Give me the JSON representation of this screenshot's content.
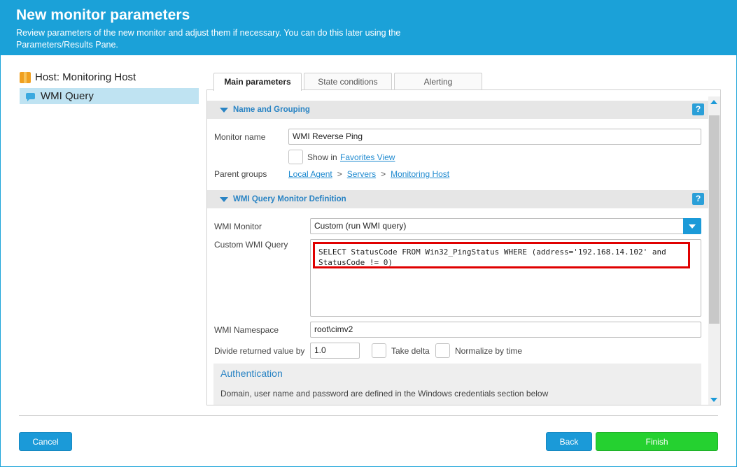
{
  "header": {
    "title": "New monitor parameters",
    "subtitle": "Review parameters of the new monitor and adjust them if necessary. You can do this later using the Parameters/Results Pane."
  },
  "tree": {
    "host_label": "Host: Monitoring Host",
    "monitor_label": "WMI Query"
  },
  "tabs": [
    {
      "label": "Main parameters",
      "active": true
    },
    {
      "label": "State conditions",
      "active": false
    },
    {
      "label": "Alerting",
      "active": false
    }
  ],
  "name_section": {
    "title": "Name and Grouping",
    "monitor_name_label": "Monitor name",
    "monitor_name_value": "WMI Reverse Ping",
    "show_in_label": "Show in",
    "favorites_link": "Favorites View",
    "parent_groups_label": "Parent groups",
    "parent_groups": [
      "Local Agent",
      "Servers",
      "Monitoring Host"
    ],
    "separator": ">"
  },
  "wmi_section": {
    "title": "WMI Query Monitor Definition",
    "wmi_monitor_label": "WMI Monitor",
    "wmi_monitor_value": "Custom (run WMI query)",
    "custom_query_label": "Custom WMI Query",
    "custom_query_value": "SELECT StatusCode FROM Win32_PingStatus WHERE (address='192.168.14.102' and StatusCode != 0)",
    "namespace_label": "WMI Namespace",
    "namespace_value": "root\\cimv2",
    "divide_label": "Divide returned value by",
    "divide_value": "1.0",
    "take_delta_label": "Take delta",
    "normalize_label": "Normalize by time"
  },
  "auth": {
    "title": "Authentication",
    "description": "Domain, user name and password are defined in the Windows credentials section below"
  },
  "help_glyph": "?",
  "footer": {
    "cancel_label": "Cancel",
    "back_label": "Back",
    "finish_label": "Finish"
  },
  "colors": {
    "accent": "#1ba1d8",
    "finish": "#25d130",
    "highlight": "#e00000"
  }
}
